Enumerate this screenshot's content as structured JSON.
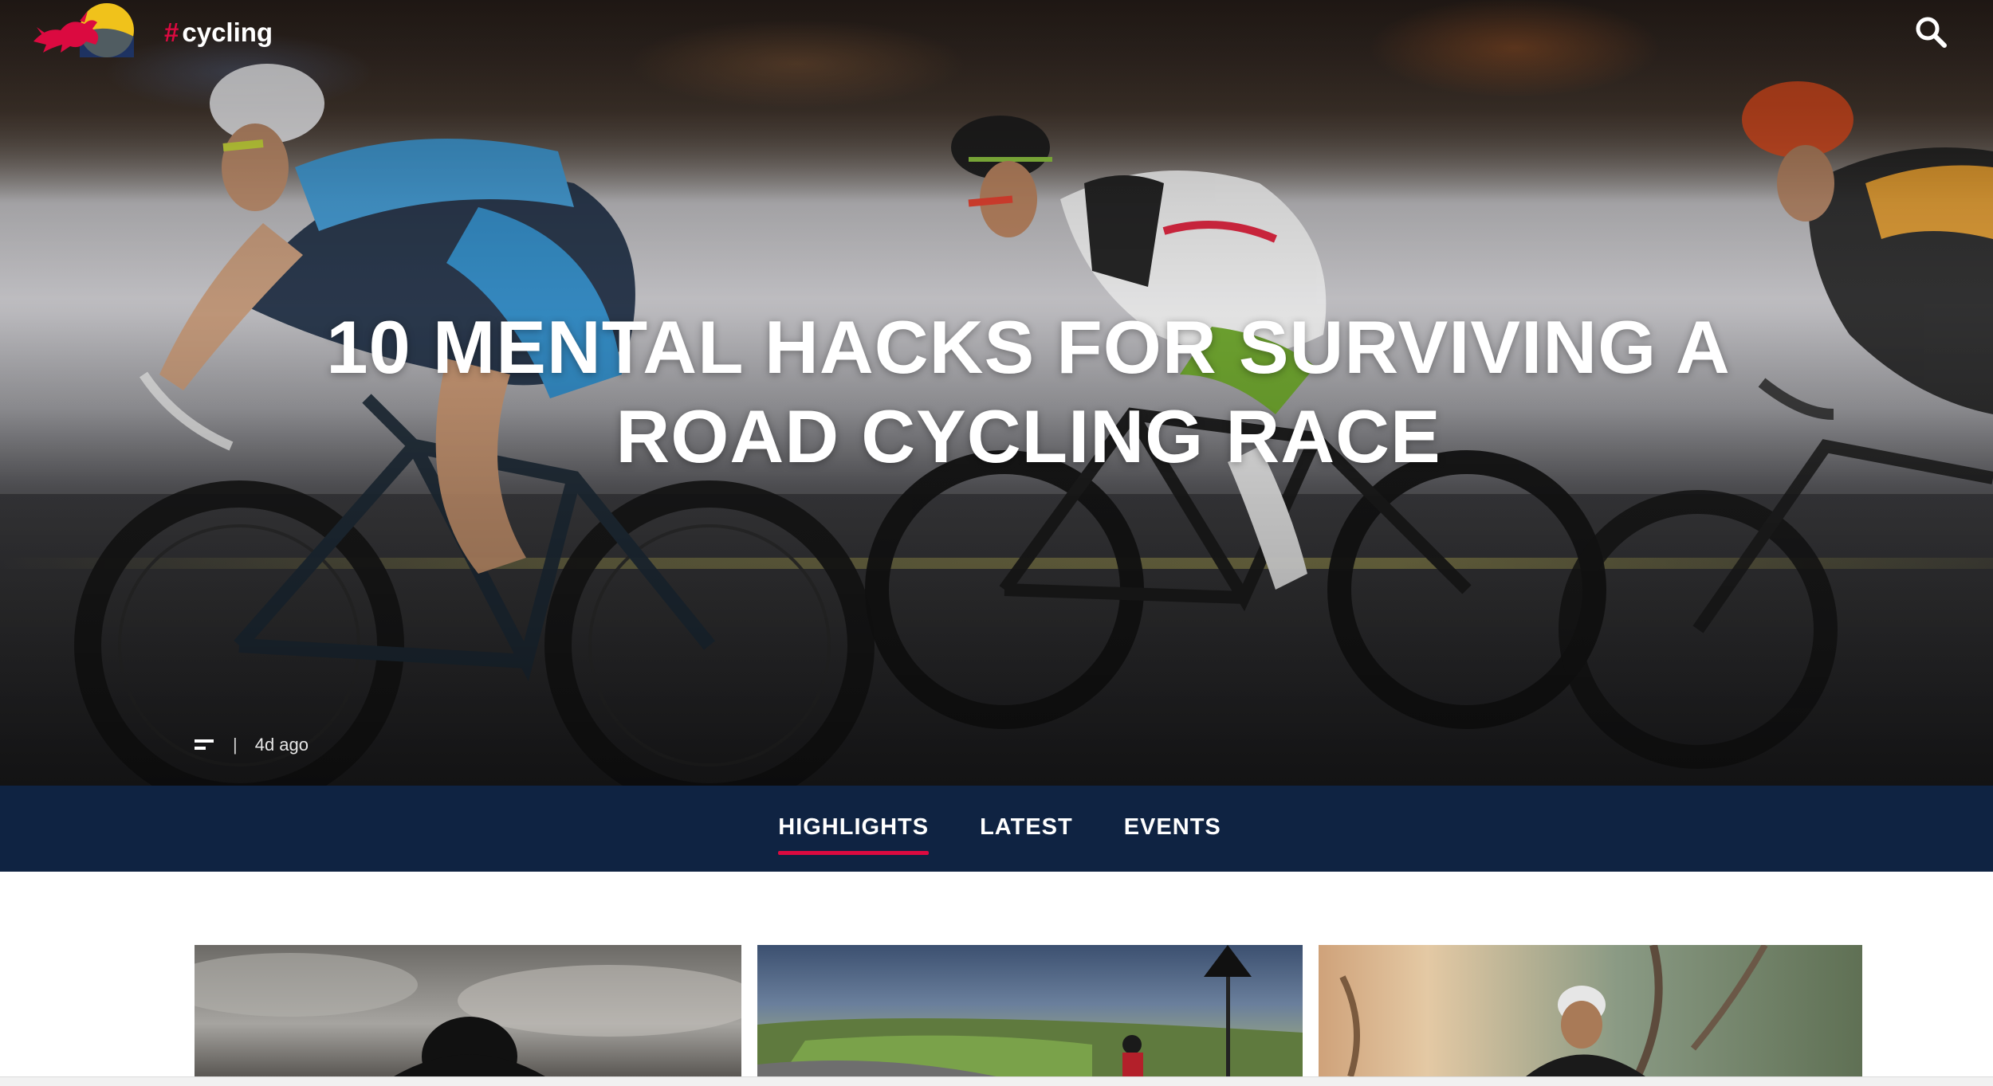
{
  "site": {
    "logo_icon": "red-bull-logo-icon",
    "hashtag": "cycling",
    "hashtag_symbol": "#",
    "search_icon": "search-icon",
    "brand_red": "#db0a40",
    "nav_blue": "#0f2342"
  },
  "hero": {
    "title": "10 MENTAL HACKS FOR SURVIVING A ROAD CYCLING RACE",
    "type_icon": "article-icon",
    "divider": "|",
    "time_ago": "4d ago"
  },
  "tabs": [
    {
      "label": "HIGHLIGHTS",
      "active": true
    },
    {
      "label": "LATEST",
      "active": false
    },
    {
      "label": "EVENTS",
      "active": false
    }
  ],
  "cards": [
    {
      "image": "cyclist-cloudy-sky-photo"
    },
    {
      "image": "cyclist-countryside-road-photo"
    },
    {
      "image": "cyclist-forest-photo"
    }
  ]
}
